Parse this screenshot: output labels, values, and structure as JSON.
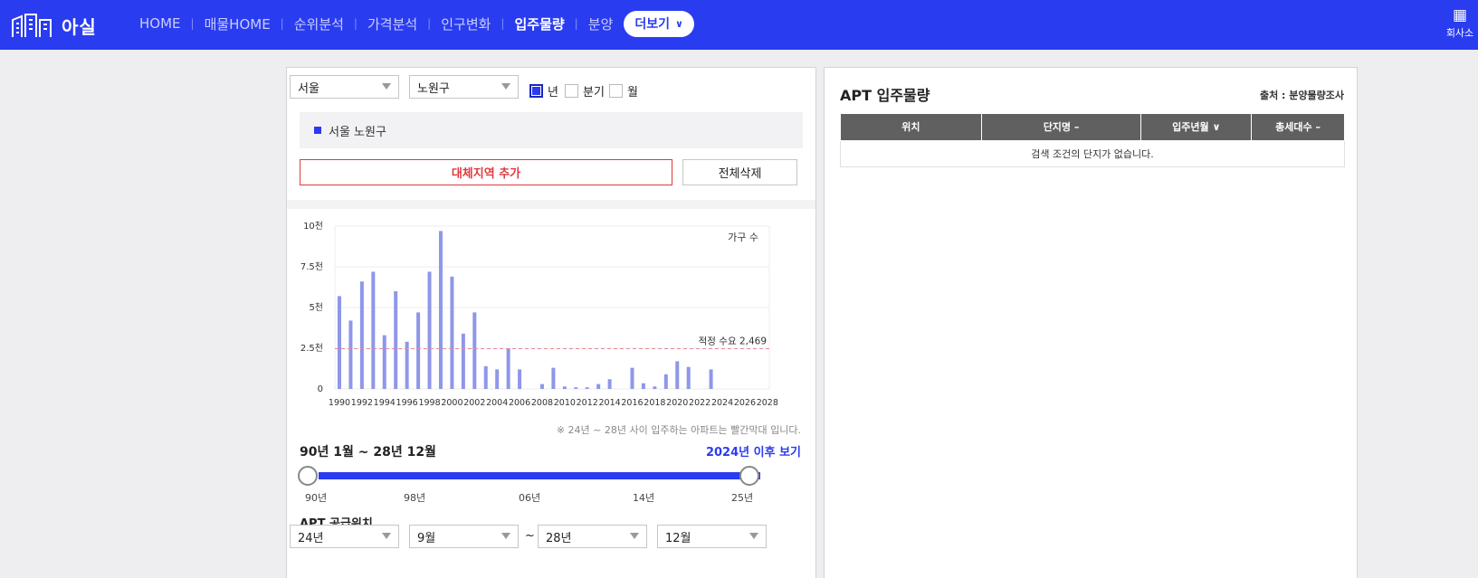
{
  "header": {
    "logo_text": "아실",
    "nav": [
      {
        "label": "HOME",
        "active": false
      },
      {
        "label": "매물HOME",
        "active": false
      },
      {
        "label": "순위분석",
        "active": false
      },
      {
        "label": "가격분석",
        "active": false
      },
      {
        "label": "인구변화",
        "active": false
      },
      {
        "label": "입주물량",
        "active": true
      },
      {
        "label": "분양",
        "active": false
      }
    ],
    "more_label": "더보기",
    "company_label": "회사소"
  },
  "filters": {
    "city": "서울",
    "district": "노원구",
    "periods": [
      {
        "label": "년",
        "checked": true
      },
      {
        "label": "분기",
        "checked": false
      },
      {
        "label": "월",
        "checked": false
      }
    ]
  },
  "selected_area": "서울 노원구",
  "buttons": {
    "add_alt_region": "대체지역 추가",
    "delete_all": "전체삭제"
  },
  "chart_data": {
    "type": "bar",
    "legend": "가구 수",
    "y_tick_labels": [
      "0",
      "2.5천",
      "5천",
      "7.5천",
      "10천"
    ],
    "ylim": [
      0,
      10000
    ],
    "x_tick_labels": [
      "1990",
      "1992",
      "1994",
      "1996",
      "1998",
      "2000",
      "2002",
      "2004",
      "2006",
      "2008",
      "2010",
      "2012",
      "2014",
      "2016",
      "2018",
      "2020",
      "2022",
      "2024",
      "2026",
      "2028"
    ],
    "categories": [
      "1990",
      "1991",
      "1992",
      "1993",
      "1994",
      "1995",
      "1996",
      "1997",
      "1998",
      "1999",
      "2000",
      "2001",
      "2002",
      "2003",
      "2004",
      "2005",
      "2006",
      "2007",
      "2008",
      "2009",
      "2010",
      "2011",
      "2012",
      "2013",
      "2014",
      "2015",
      "2016",
      "2017",
      "2018",
      "2019",
      "2020",
      "2021",
      "2022",
      "2023",
      "2024",
      "2025",
      "2026",
      "2027",
      "2028"
    ],
    "values": [
      5700,
      4200,
      6600,
      7200,
      3300,
      6000,
      2900,
      4700,
      7200,
      9700,
      6900,
      3400,
      4700,
      1400,
      1200,
      2500,
      1200,
      0,
      300,
      1300,
      150,
      100,
      100,
      300,
      600,
      0,
      1300,
      350,
      150,
      900,
      1700,
      1350,
      0,
      1200,
      0,
      0,
      0,
      0,
      0
    ],
    "reference_line": {
      "label": "적정 수요 2,469",
      "value": 2469
    },
    "bar_color": "#8e97e8",
    "ref_color": "#e88a9a"
  },
  "notice": "※ 24년 ~ 28년 사이 입주하는 아파트는 빨간막대 입니다.",
  "period_range": "90년 1월 ~ 28년 12월",
  "view_after": "2024년 이후 보기",
  "slider": {
    "min_fraction": 0,
    "max_fraction": 1,
    "tick_labels": [
      "90년",
      "98년",
      "06년",
      "14년",
      "25년"
    ]
  },
  "supply": {
    "title": "APT 공급위치",
    "from_year": "24년",
    "from_month": "9월",
    "tilde": "~",
    "to_year": "28년",
    "to_month": "12월"
  },
  "right_panel": {
    "title": "APT 입주물량",
    "source": "출처 : 분양물량조사",
    "columns": [
      "위치",
      "단지명 –",
      "입주년월 ∨",
      "총세대수 –"
    ],
    "empty_message": "검색 조건의 단지가 없습니다."
  }
}
